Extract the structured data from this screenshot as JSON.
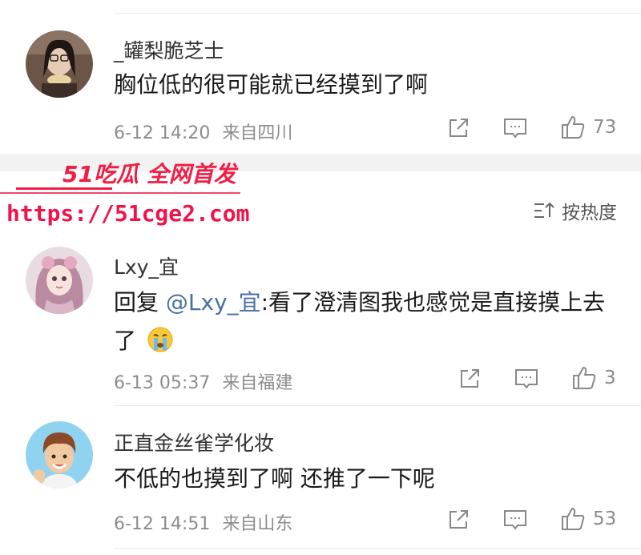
{
  "comments": [
    {
      "username": "_罐梨脆芝士",
      "text": "胸位低的很可能就已经摸到了啊",
      "time": "6-12 14:20",
      "location": "来自四川",
      "likes": "73"
    },
    {
      "username": "Lxy_宜",
      "reply_prefix": "回复 ",
      "mention": "@Lxy_宜",
      "text": ":看了澄清图我也感觉是直接摸上去了",
      "emoji_icon": "crying-face-icon",
      "time": "6-13 05:37",
      "location": "来自福建",
      "likes": "3"
    },
    {
      "username": "正直金丝雀学化妆",
      "text": "不低的也摸到了啊  还推了一下呢",
      "time": "6-12 14:51",
      "location": "来自山东",
      "likes": "53"
    }
  ],
  "sort": {
    "label": "按热度",
    "icon": "sort-icon"
  },
  "watermark": {
    "brand": "51吃瓜 全网首发",
    "url": "https://51cge2.com"
  },
  "colors": {
    "accent_red": "#f01d45",
    "mention_blue": "#4a6fa5",
    "meta_gray": "#8c8c8c"
  }
}
